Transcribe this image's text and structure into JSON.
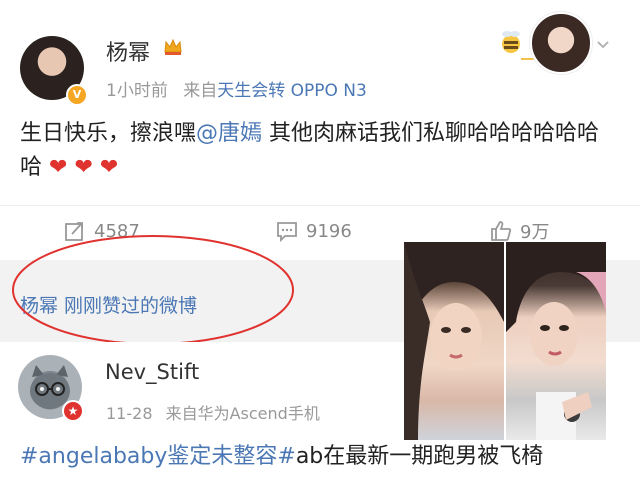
{
  "post1": {
    "author": "杨幂",
    "time": "1小时前",
    "via": "来自",
    "source": "天生会转 OPPO N3",
    "text_before": "生日快乐，擦浪嘿",
    "mention": "@唐嫣",
    "text_after": " 其他肉麻话我们私聊哈哈哈哈哈哈哈",
    "hearts": "❤ ❤ ❤",
    "repost_count": "4587",
    "comment_count": "9196",
    "like_count": "9万"
  },
  "liked_section": {
    "label": "杨幂 刚刚赞过的微博"
  },
  "post2": {
    "author": "Nev_Stift",
    "time": "11-28",
    "source": "来自华为Ascend手机",
    "text_hashtag": "#angelababy鉴定未整容#",
    "text_rest": "ab在最新一期跑男被飞椅"
  },
  "colors": {
    "link": "#4b78b5",
    "heart": "#e0322f",
    "annotation": "#e0322f",
    "verified_badge": "#f5a623"
  },
  "icons": [
    "crown-icon",
    "verified-icon",
    "chevron-down-icon",
    "repost-icon",
    "comment-icon",
    "like-icon",
    "red-badge-icon"
  ]
}
